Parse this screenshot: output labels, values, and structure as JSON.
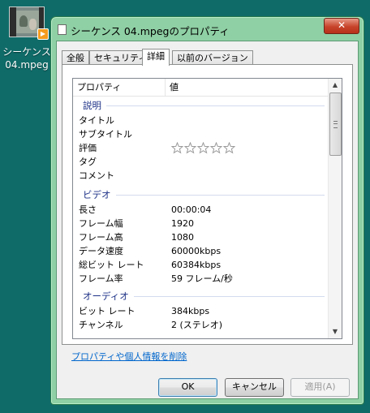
{
  "desktop_icon": {
    "label_line1": "シーケンス",
    "label_line2": "04.mpeg",
    "badge": "▶"
  },
  "window": {
    "title": "シーケンス 04.mpegのプロパティ",
    "close_glyph": "✕",
    "tabs": [
      {
        "label": "全般",
        "active": false
      },
      {
        "label": "セキュリティ",
        "active": false
      },
      {
        "label": "詳細",
        "active": true
      },
      {
        "label": "以前のバージョン",
        "active": false
      }
    ],
    "columns": {
      "property": "プロパティ",
      "value": "値"
    },
    "groups": {
      "description": "説明",
      "video": "ビデオ",
      "audio": "オーディオ"
    },
    "description_rows": [
      {
        "key": "タイトル",
        "value": ""
      },
      {
        "key": "サブタイトル",
        "value": ""
      },
      {
        "key": "評価",
        "value": ""
      },
      {
        "key": "タグ",
        "value": ""
      },
      {
        "key": "コメント",
        "value": ""
      }
    ],
    "rating": {
      "stars_filled": 0,
      "stars_total": 5
    },
    "video_rows": [
      {
        "key": "長さ",
        "value": "00:00:04"
      },
      {
        "key": "フレーム幅",
        "value": "1920"
      },
      {
        "key": "フレーム高",
        "value": "1080"
      },
      {
        "key": "データ速度",
        "value": "60000kbps"
      },
      {
        "key": "総ビット レート",
        "value": "60384kbps"
      },
      {
        "key": "フレーム率",
        "value": "59 フレーム/秒"
      }
    ],
    "audio_rows": [
      {
        "key": "ビット レート",
        "value": "384kbps"
      },
      {
        "key": "チャンネル",
        "value": "2 (ステレオ)"
      }
    ],
    "remove_link": "プロパティや個人情報を削除",
    "buttons": {
      "ok": "OK",
      "cancel": "キャンセル",
      "apply": "適用(A)"
    }
  }
}
